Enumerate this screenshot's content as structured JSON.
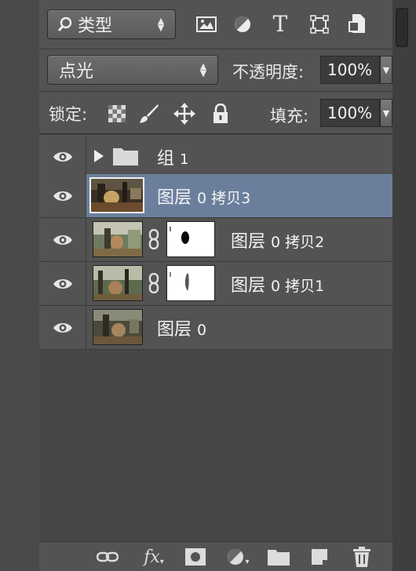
{
  "filter": {
    "kind_label": "类型",
    "icons": [
      "image-filter-icon",
      "adjustment-filter-icon",
      "type-filter-icon",
      "shape-filter-icon",
      "smart-object-filter-icon"
    ],
    "type_glyph": "T"
  },
  "blend": {
    "mode": "点光",
    "opacity_label": "不透明度:",
    "opacity_value": "100%"
  },
  "lock": {
    "label": "锁定:",
    "fill_label": "填充:",
    "fill_value": "100%"
  },
  "layers": [
    {
      "name_prefix": "组",
      "name_suffix": "1",
      "type": "group",
      "selected": false
    },
    {
      "name_prefix": "图层",
      "name_suffix": "0 拷贝3",
      "type": "image",
      "selected": true
    },
    {
      "name_prefix": "图层",
      "name_suffix": "0 拷贝2",
      "type": "image-with-mask",
      "selected": false
    },
    {
      "name_prefix": "图层",
      "name_suffix": "0 拷贝1",
      "type": "image-with-mask",
      "selected": false
    },
    {
      "name_prefix": "图层",
      "name_suffix": "0",
      "type": "image",
      "selected": false
    }
  ],
  "bottom_icons": [
    "link-layers-icon",
    "fx-icon",
    "add-mask-icon",
    "adjustment-layer-icon",
    "new-group-icon",
    "new-layer-icon",
    "delete-layer-icon"
  ],
  "fx_glyph": "fx",
  "colors": {
    "panel": "#535353",
    "selected_row": "#6b7f9d",
    "field": "#3b3b3b"
  }
}
